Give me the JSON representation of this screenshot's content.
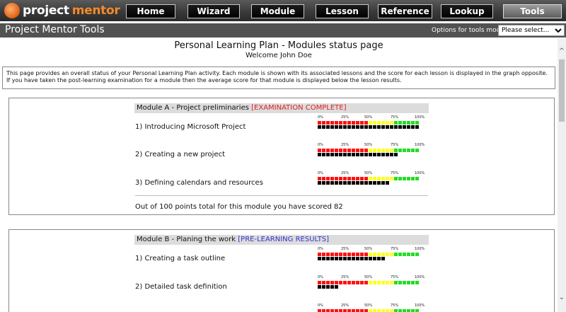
{
  "app": {
    "logo_word1": "project",
    "logo_word2": "mentor",
    "nav": [
      "Home",
      "Wizard",
      "Module",
      "Lesson",
      "Reference",
      "Lookup",
      "Tools"
    ],
    "active_nav": "Tools"
  },
  "titlebar": {
    "title": "Project Mentor Tools",
    "options_label": "Options for tools mode:",
    "select_value": "Please select..."
  },
  "page": {
    "title": "Personal Learning Plan - Modules status page",
    "welcome": "Welcome John Doe",
    "intro": "This page provides an overall status of your Personal Learning Plan activity.  Each module is shown with its associated lessons and the score for each lesson is displayed in the graph opposite.  If you have taken the post-learning examination for a module then the average score for that module is displayed below the lesson results."
  },
  "scale_labels": [
    "0%",
    "25%",
    "50%",
    "75%",
    "100%"
  ],
  "modules": [
    {
      "title": "Module A - Project preliminaries",
      "status": "[EXAMINATION COMPLETE]",
      "status_type": "complete",
      "lessons": [
        {
          "name": "1) Introducing Microsoft Project",
          "score_pct": 100
        },
        {
          "name": "2) Creating a new project",
          "score_pct": 80
        },
        {
          "name": "3) Defining calendars and resources",
          "score_pct": 70
        }
      ],
      "summary": "Out of 100 points total for this module you have scored 82"
    },
    {
      "title": "Module B - Planing the work",
      "status": "[PRE-LEARNING RESULTS]",
      "status_type": "pre",
      "lessons": [
        {
          "name": "1) Creating a task outline",
          "score_pct": 65
        },
        {
          "name": "2) Detailed task definition",
          "score_pct": 20
        },
        {
          "name": "",
          "score_pct": 0
        }
      ],
      "summary": ""
    }
  ],
  "colors": {
    "scale_low": "#ff1111",
    "scale_mid": "#ffff22",
    "scale_high": "#22dd22",
    "score": "#000000",
    "status_complete": "#e02020",
    "status_pre": "#3333cc"
  }
}
